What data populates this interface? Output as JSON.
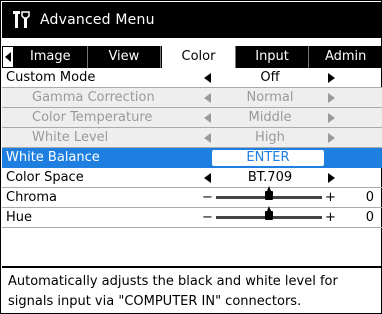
{
  "window": {
    "title": "Advanced Menu",
    "icon": "tools-icon"
  },
  "tabs": {
    "items": [
      {
        "label": "Image",
        "active": false
      },
      {
        "label": "View",
        "active": false
      },
      {
        "label": "Color",
        "active": true
      },
      {
        "label": "Input",
        "active": false
      },
      {
        "label": "Admin",
        "active": false
      }
    ]
  },
  "menu": {
    "custom_mode": {
      "label": "Custom Mode",
      "value": "Off"
    },
    "gamma": {
      "label": "Gamma Correction",
      "value": "Normal"
    },
    "color_temp": {
      "label": "Color Temperature",
      "value": "Middle"
    },
    "white_level": {
      "label": "White Level",
      "value": "High"
    },
    "white_balance": {
      "label": "White Balance",
      "button": "ENTER"
    },
    "color_space": {
      "label": "Color Space",
      "value": "BT.709"
    },
    "chroma": {
      "label": "Chroma",
      "minus": "−",
      "plus": "+",
      "value": "0",
      "level": 0.5
    },
    "hue": {
      "label": "Hue",
      "minus": "−",
      "plus": "+",
      "value": "0",
      "level": 0.5
    }
  },
  "description": {
    "line1": "Automatically adjusts the black and white level for",
    "line2": "signals input via \"COMPUTER IN\" connectors."
  },
  "colors": {
    "highlight": "#1e7fe0",
    "disabled": "#9a9a9a"
  }
}
